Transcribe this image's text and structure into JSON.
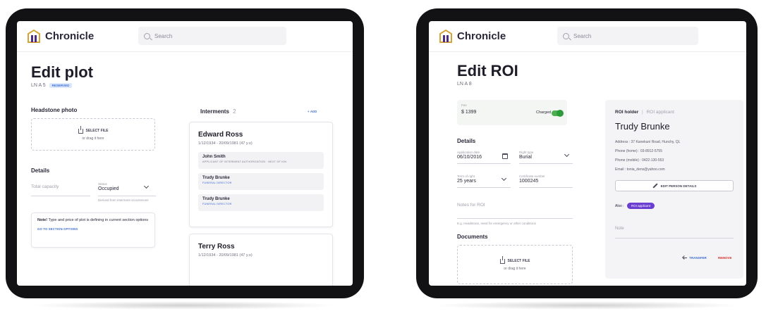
{
  "brand": "Chronicle",
  "search_placeholder": "Search",
  "left": {
    "title": "Edit plot",
    "plot_code": "LN A 5",
    "status_badge": "RESERVED",
    "headstone_title": "Headstone photo",
    "select_file": "SELECT FILE",
    "drag_hint": "or drag it here",
    "details_title": "Details",
    "total_capacity_placeholder": "Total capacity",
    "status_label": "Status",
    "status_value": "Occupied",
    "status_hint": "Derived from interment occurrences",
    "note_bold": "Note!",
    "note_text": "Type and price of plot is defining in current section options",
    "note_link": "GO TO SECTION OPTIONS",
    "interments_title": "Interments",
    "interments_count": "2",
    "add_label": "+ ADD",
    "interments": [
      {
        "name": "Edward Ross",
        "dates": "1/12/1934 - 20/09/1981 (47 y.o)",
        "contacts": [
          {
            "name": "John Smith",
            "role": "APPLICANT OF INTERMENT AUTHORIZATION · NEXT OF KIN"
          },
          {
            "name": "Trudy Brunke",
            "role": "FUNERAL DIRECTOR"
          },
          {
            "name": "Trudy Brunke",
            "role": "FUNERAL DIRECTOR"
          }
        ]
      },
      {
        "name": "Terry Ross",
        "dates": "1/12/1934 - 20/09/1981 (47 y.o)"
      }
    ]
  },
  "right": {
    "title": "Edit ROI",
    "plot_code": "LN A 8",
    "fee_label": "Fee",
    "fee_value": "$ 1399",
    "charged_label": "Charged",
    "details_title": "Details",
    "application_date_label": "Application date",
    "application_date_value": "06/10/2016",
    "right_type_label": "Right type",
    "right_type_value": "Burial",
    "term_label": "Term of right",
    "term_value": "25 years",
    "certificate_label": "Certificate number",
    "certificate_value": "1000245",
    "notes_placeholder": "Notes for ROI",
    "notes_hint": "E.g. Headstone, need for emergency or other conditions",
    "documents_title": "Documents",
    "select_file": "SELECT FILE",
    "drag_hint": "or drag it here",
    "holder": {
      "tab_active": "ROI holder",
      "tab_inactive": "ROI applicant",
      "name": "Trudy Brunke",
      "address": "Address : 37 Kanekuni Road, Hunchy, QL",
      "phone_home": "Phone (home) : 03-8912-5755",
      "phone_mobile": "Phone (mobile) : 0422-130-553",
      "email": "Email : tonia_dens@yahoo.com",
      "edit_button": "EDIT PERSON DETAILS",
      "also_label": "Also :",
      "also_pill": "ROI applicant",
      "note_placeholder": "Note",
      "transfer_label": "TRANSFER",
      "remove_label": "REMOVE"
    }
  },
  "colors": {
    "link_blue": "#3e6bd0",
    "toggle_green": "#2e9b3b",
    "pill_purple": "#6a3ed1",
    "remove_red": "#d0342c"
  }
}
